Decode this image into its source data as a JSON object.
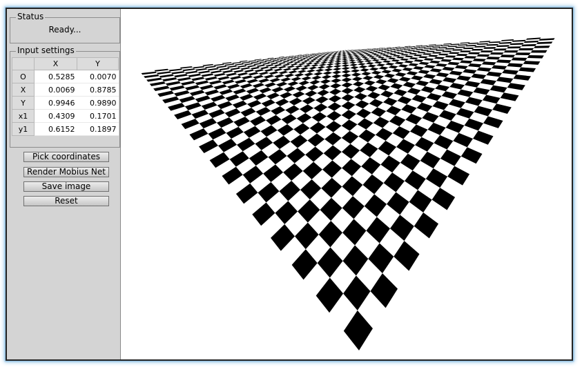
{
  "status": {
    "title": "Status",
    "text": "Ready..."
  },
  "input_settings": {
    "title": "Input settings",
    "columns": [
      "X",
      "Y"
    ],
    "rows": [
      {
        "label": "O",
        "x": "0.5285",
        "y": "0.0070"
      },
      {
        "label": "X",
        "x": "0.0069",
        "y": "0.8785"
      },
      {
        "label": "Y",
        "x": "0.9946",
        "y": "0.9890"
      },
      {
        "label": "x1",
        "x": "0.4309",
        "y": "0.1701"
      },
      {
        "label": "y1",
        "x": "0.6152",
        "y": "0.1897"
      }
    ]
  },
  "buttons": {
    "pick": "Pick coordinates",
    "render": "Render Mobius Net",
    "save": "Save image",
    "reset": "Reset"
  },
  "colors": {
    "checker_dark": "#000000",
    "checker_light": "#ffffff",
    "window_glow": "#9cc8e8"
  }
}
